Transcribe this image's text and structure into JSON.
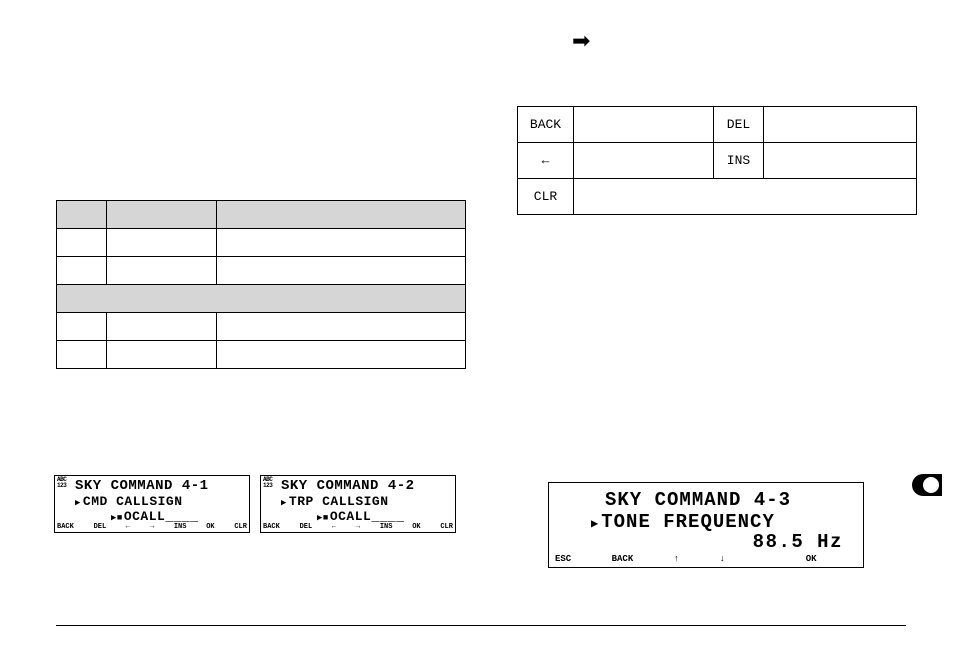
{
  "arrow_right": "➜",
  "left_table": {
    "rows": [
      {
        "type": "header",
        "c1": "",
        "c2": "",
        "c3": ""
      },
      {
        "type": "data",
        "c1": "",
        "c2": "",
        "c3": ""
      },
      {
        "type": "data",
        "c1": "",
        "c2": "",
        "c3": ""
      },
      {
        "type": "header",
        "c1": "",
        "c2": "",
        "c3": ""
      },
      {
        "type": "data",
        "c1": "",
        "c2": "",
        "c3": ""
      },
      {
        "type": "data",
        "c1": "",
        "c2": "",
        "c3": ""
      }
    ]
  },
  "key_table": {
    "rows": [
      {
        "k1": "BACK",
        "k2": "",
        "k3": "DEL",
        "k4": ""
      },
      {
        "k1": "←",
        "k2": "",
        "k3": "INS",
        "k4": ""
      }
    ],
    "last": {
      "k1": "CLR",
      "desc": ""
    }
  },
  "lcd1": {
    "abc_top": "ABC",
    "abc_bot": "123",
    "line1": "SKY COMMAND 4-1",
    "line2": "CMD CALLSIGN",
    "line3": "OCALL____",
    "soft": [
      "BACK",
      "DEL",
      "←",
      "→",
      "INS",
      "OK",
      "CLR"
    ]
  },
  "lcd2": {
    "abc_top": "ABC",
    "abc_bot": "123",
    "line1": "SKY COMMAND 4-2",
    "line2": "TRP CALLSIGN",
    "line3": "OCALL____",
    "soft": [
      "BACK",
      "DEL",
      "←",
      "→",
      "INS",
      "OK",
      "CLR"
    ]
  },
  "lcd3": {
    "line1": "SKY COMMAND 4-3",
    "line2": "TONE FREQUENCY",
    "line3": "88.5 Hz",
    "soft": [
      "ESC",
      "BACK",
      "↑",
      "↓",
      "",
      "OK",
      ""
    ]
  }
}
